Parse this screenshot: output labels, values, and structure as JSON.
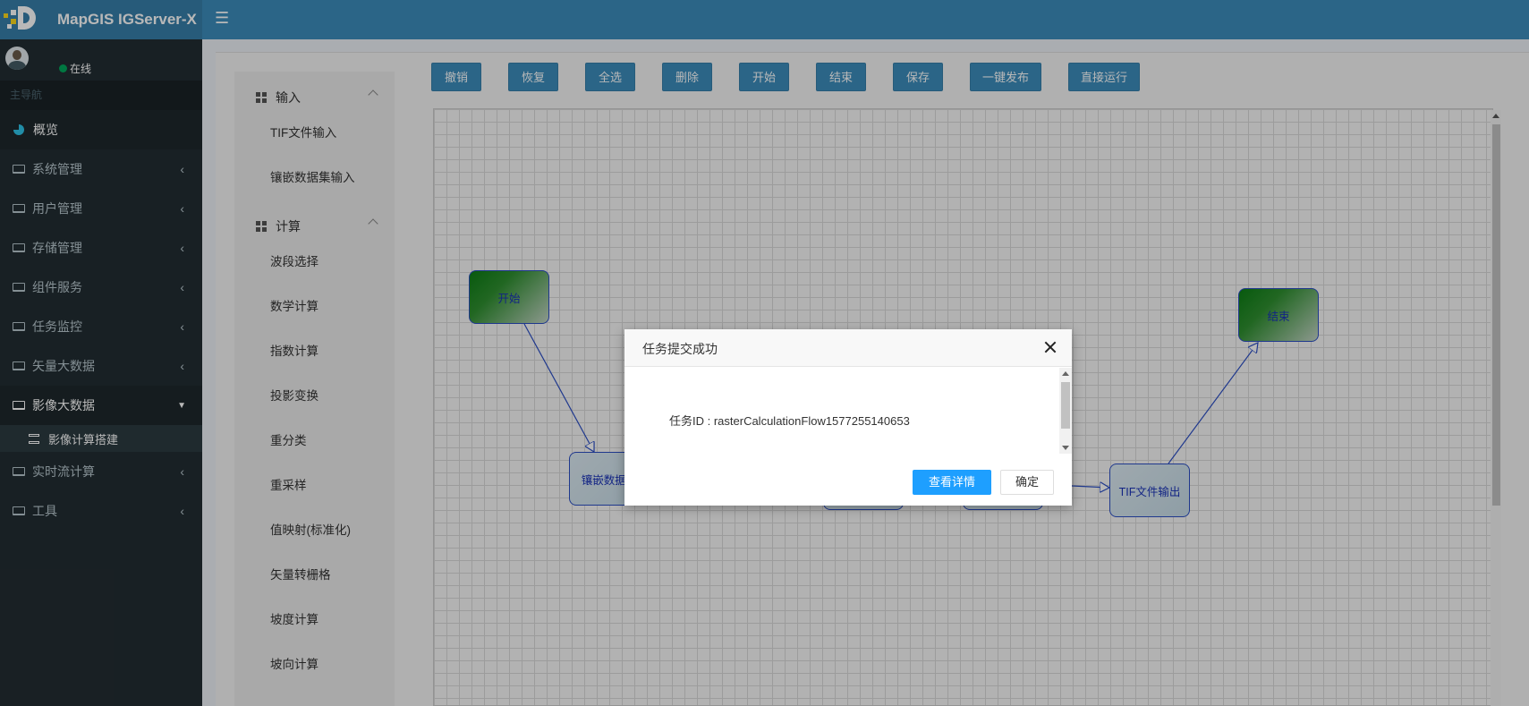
{
  "app": {
    "title": "MapGIS IGServer-X"
  },
  "user": {
    "status": "在线"
  },
  "sidebar": {
    "header": "主导航",
    "items": [
      {
        "label": "概览"
      },
      {
        "label": "系统管理"
      },
      {
        "label": "用户管理"
      },
      {
        "label": "存储管理"
      },
      {
        "label": "组件服务"
      },
      {
        "label": "任务监控"
      },
      {
        "label": "矢量大数据"
      },
      {
        "label": "影像大数据"
      },
      {
        "label": "实时流计算"
      },
      {
        "label": "工具"
      }
    ],
    "sub_item": "影像计算搭建"
  },
  "tools": {
    "group_input": "输入",
    "input_items": [
      "TIF文件输入",
      "镶嵌数据集输入"
    ],
    "group_compute": "计算",
    "compute_items": [
      "波段选择",
      "数学计算",
      "指数计算",
      "投影变换",
      "重分类",
      "重采样",
      "值映射(标准化)",
      "矢量转栅格",
      "坡度计算",
      "坡向计算"
    ]
  },
  "toolbar": {
    "buttons": [
      "撤销",
      "恢复",
      "全选",
      "删除",
      "开始",
      "结束",
      "保存",
      "一键发布",
      "直接运行"
    ]
  },
  "flow": {
    "nodes": {
      "start": "开始",
      "mosaic": "镶嵌数据集",
      "tif_out": "TIF文件输出",
      "end": "结束"
    }
  },
  "modal": {
    "title": "任务提交成功",
    "task_id_label": "任务ID : rasterCalculationFlow1577255140653",
    "detail_button": "查看详情",
    "ok_button": "确定"
  },
  "colors": {
    "header": "#3c8dbc",
    "sidebar": "#222d32",
    "primary_button": "#1e9fff"
  }
}
